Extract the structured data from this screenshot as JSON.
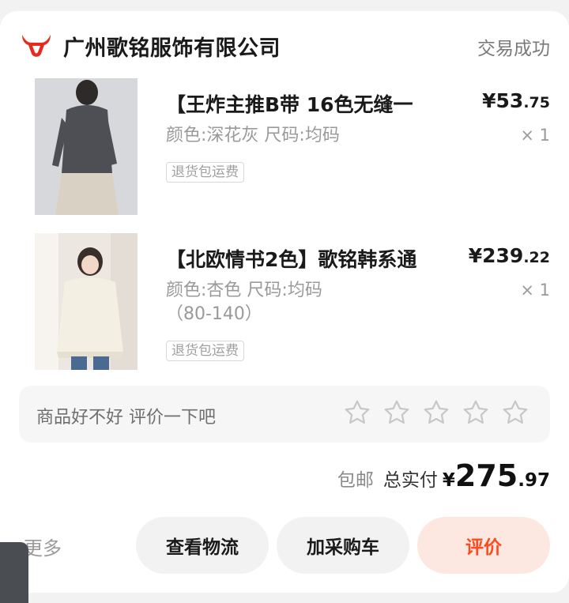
{
  "shop": {
    "name": "广州歌铭服饰有限公司",
    "status": "交易成功",
    "logo_icon": "red-bull-head-icon",
    "brand_color": "#e62b1e"
  },
  "items": [
    {
      "title": "【王炸主推B带  16色无缝一",
      "price_yen": "¥",
      "price_int": "53",
      "price_dec": ".75",
      "spec_line1": "颜色:深花灰 尺码:均码",
      "spec_line2": "",
      "qty": "× 1",
      "badge": "退货包运费"
    },
    {
      "title": "【北欧情书2色】歌铭韩系通",
      "price_yen": "¥",
      "price_int": "239",
      "price_dec": ".22",
      "spec_line1": "颜色:杏色 尺码:均码",
      "spec_line2": "（80-140）",
      "qty": "× 1",
      "badge": "退货包运费"
    }
  ],
  "review": {
    "prompt": "商品好不好 评价一下吧",
    "stars": 5,
    "rating": 0
  },
  "total": {
    "free_shipping": "包邮",
    "label": "总实付",
    "yen": "¥",
    "int": "275",
    "dec": ".97"
  },
  "actions": {
    "more": "更多",
    "logistics": "查看物流",
    "add_cart": "加采购车",
    "review": "评价",
    "review_color": "#ff4a1f"
  }
}
